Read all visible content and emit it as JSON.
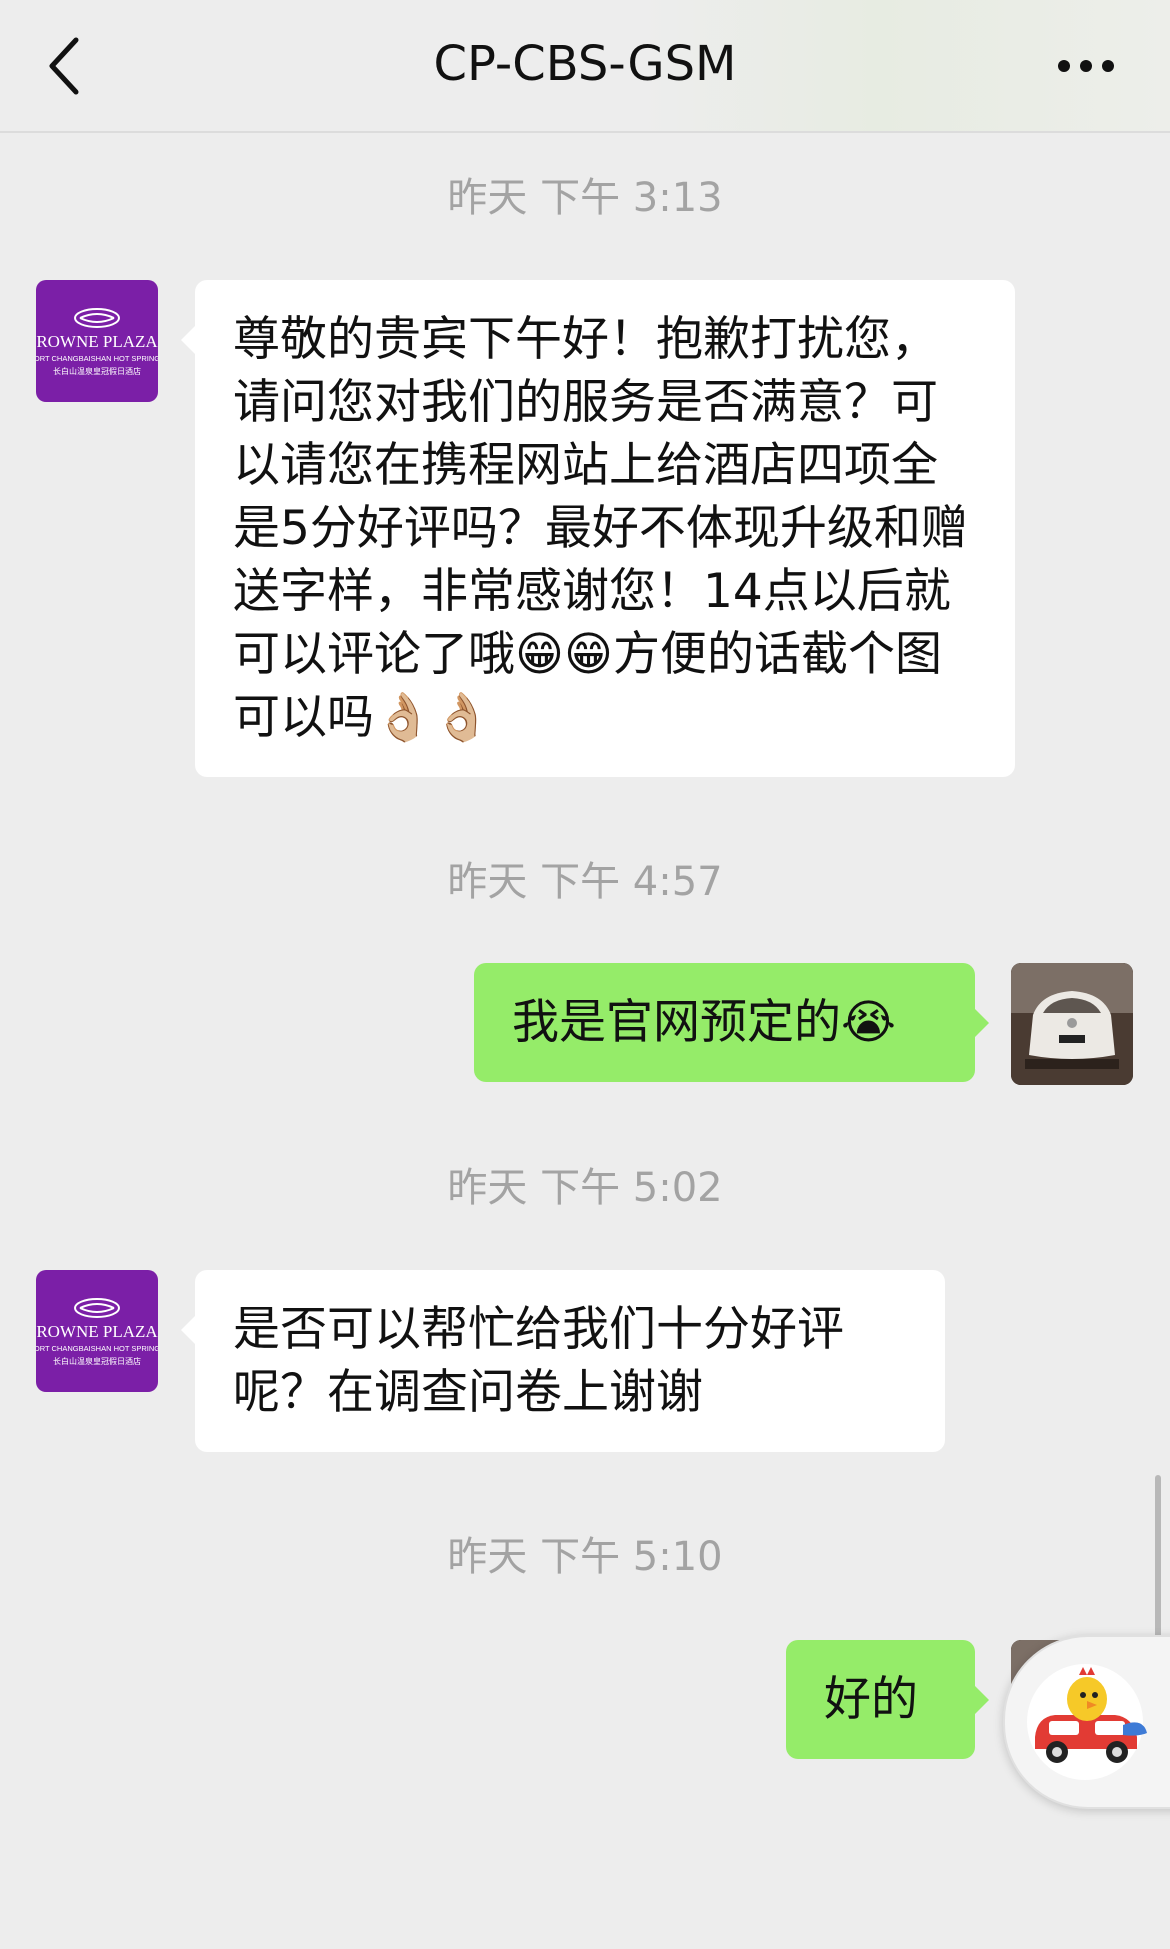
{
  "header": {
    "title": "CP-CBS-GSM",
    "back_icon": "chevron-left-icon",
    "more_icon": "more-horizontal-icon"
  },
  "hotel_avatar": {
    "line1": "ROWNE PLAZA",
    "line2": "ORT CHANGBAISHAN HOT SPRING",
    "line3": "长白山温泉皇冠假日酒店",
    "color": "#7b1fa7"
  },
  "messages": [
    {
      "time": "昨天 下午 3:13",
      "sender": "hotel",
      "text": "尊敬的贵宾下午好！抱歉打扰您，请问您对我们的服务是否满意？可以请您在携程网站上给酒店四项全是5分好评吗？最好不体现升级和赠送字样，非常感谢您！14点以后就可以评论了哦😁😁方便的话截个图可以吗👌🏼👌🏼"
    },
    {
      "time": "昨天 下午 4:57",
      "sender": "me",
      "text": "我是官网预定的😭"
    },
    {
      "time": "昨天 下午 5:02",
      "sender": "hotel",
      "text": "是否可以帮忙给我们十分好评呢？在调查问卷上谢谢"
    },
    {
      "time": "昨天 下午 5:10",
      "sender": "me",
      "text": "好的"
    }
  ],
  "colors": {
    "background": "#ededed",
    "incoming_bubble": "#ffffff",
    "outgoing_bubble": "#95ec69",
    "timestamp": "#a3a3a3"
  },
  "floating_button": {
    "icon": "chick-mascot-icon"
  }
}
